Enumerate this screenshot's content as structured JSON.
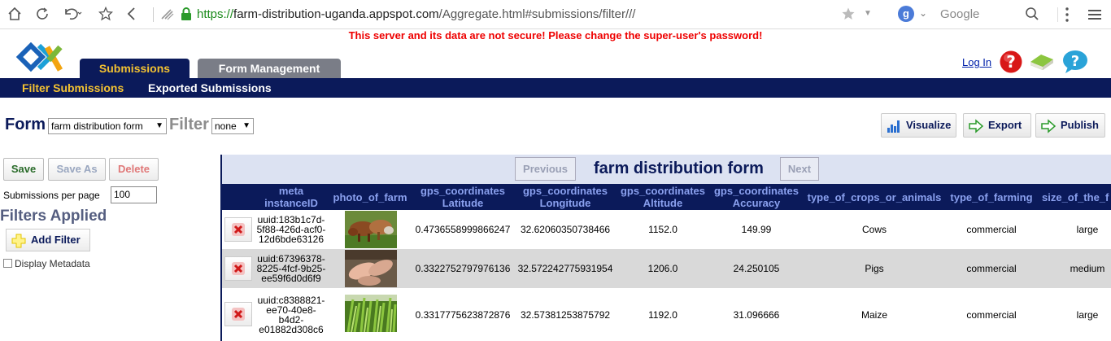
{
  "browser": {
    "url_scheme": "https://",
    "url_host": "farm-distribution-uganda.appspot.com",
    "url_path": "/Aggregate.html#submissions/filter///",
    "search_engine_badge": "g",
    "search_placeholder": "Google",
    "icons": [
      "home-icon",
      "reload-icon",
      "undo-icon",
      "star-icon",
      "back-icon",
      "lock-icon",
      "bookmark-star-icon",
      "menu-icon",
      "search-icon"
    ]
  },
  "warning": "This server and its data are not secure! Please change the super-user's password!",
  "tabs": [
    {
      "label": "Submissions",
      "active": true
    },
    {
      "label": "Form Management",
      "active": false
    }
  ],
  "top_links": {
    "login": "Log In"
  },
  "subnav": [
    {
      "label": "Filter Submissions",
      "active": true
    },
    {
      "label": "Exported Submissions",
      "active": false
    }
  ],
  "form_selector": {
    "form_label": "Form",
    "form_value": "farm distribution form",
    "filter_label": "Filter",
    "filter_value": "none"
  },
  "actions": {
    "visualize": "Visualize",
    "export": "Export",
    "publish": "Publish"
  },
  "left_panel": {
    "save": "Save",
    "save_as": "Save As",
    "delete": "Delete",
    "per_page_label": "Submissions per page",
    "per_page_value": "100",
    "filters_applied": "Filters Applied",
    "add_filter": "Add Filter",
    "display_metadata": "Display Metadata"
  },
  "table": {
    "title": "farm distribution form",
    "previous": "Previous",
    "next": "Next",
    "columns": [
      {
        "line1": "meta",
        "line2": "instanceID"
      },
      {
        "line1": "photo_of_farm",
        "line2": ""
      },
      {
        "line1": "gps_coordinates",
        "line2": "Latitude"
      },
      {
        "line1": "gps_coordinates",
        "line2": "Longitude"
      },
      {
        "line1": "gps_coordinates",
        "line2": "Altitude"
      },
      {
        "line1": "gps_coordinates",
        "line2": "Accuracy"
      },
      {
        "line1": "type_of_crops_or_animals",
        "line2": ""
      },
      {
        "line1": "type_of_farming",
        "line2": ""
      },
      {
        "line1": "size_of_the_f",
        "line2": ""
      }
    ],
    "rows": [
      {
        "uuid": [
          "uuid:183b1c7d-",
          "5f88-426d-acf0-",
          "12d6bde63126"
        ],
        "photo": "cows-photo",
        "latitude": "0.4736558999866247",
        "longitude": "32.62060350738466",
        "altitude": "1152.0",
        "accuracy": "149.99",
        "crop": "Cows",
        "farming": "commercial",
        "size": "large"
      },
      {
        "uuid": [
          "uuid:67396378-",
          "8225-4fcf-9b25-",
          "ee59f6d0d6f9"
        ],
        "photo": "pigs-photo",
        "latitude": "0.3322752797976136",
        "longitude": "32.572242775931954",
        "altitude": "1206.0",
        "accuracy": "24.250105",
        "crop": "Pigs",
        "farming": "commercial",
        "size": "medium"
      },
      {
        "uuid": [
          "uuid:c8388821-",
          "ee70-40e8-",
          "b4d2-",
          "e01882d308c6"
        ],
        "photo": "maize-photo",
        "latitude": "0.3317775623872876",
        "longitude": "32.57381253875792",
        "altitude": "1192.0",
        "accuracy": "31.096666",
        "crop": "Maize",
        "farming": "commercial",
        "size": "large"
      }
    ]
  }
}
